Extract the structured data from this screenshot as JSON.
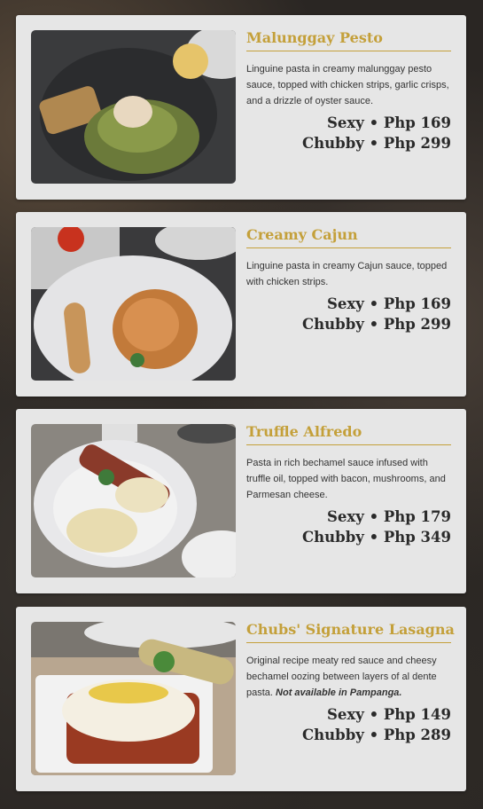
{
  "menu": {
    "items": [
      {
        "title": "Malunggay Pesto",
        "description": "Linguine pasta in creamy malunggay pesto sauce, topped with chicken strips, garlic crisps, and a drizzle of oyster sauce.",
        "note": "",
        "price_sexy": "Sexy • Php 169",
        "price_chubby": "Chubby • Php 299",
        "photo_alt": "pesto-pasta-photo"
      },
      {
        "title": "Creamy Cajun",
        "description": "Linguine pasta in creamy Cajun sauce, topped with chicken strips.",
        "note": "",
        "price_sexy": "Sexy • Php 169",
        "price_chubby": "Chubby • Php 299",
        "photo_alt": "cajun-pasta-photo"
      },
      {
        "title": "Truffle Alfredo",
        "description": "Pasta in rich bechamel sauce infused with truffle oil, topped with bacon, mushrooms, and Parmesan cheese.",
        "note": "",
        "price_sexy": "Sexy • Php 179",
        "price_chubby": "Chubby • Php 349",
        "photo_alt": "alfredo-pasta-photo"
      },
      {
        "title": "Chubs' Signature Lasagna",
        "description": "Original recipe meaty red sauce and cheesy bechamel oozing between layers of al dente pasta.",
        "note": "Not available in Pampanga.",
        "price_sexy": "Sexy • Php 149",
        "price_chubby": "Chubby • Php 289",
        "photo_alt": "lasagna-photo"
      }
    ]
  },
  "colors": {
    "title_gold": "#c4a03a",
    "card_bg": "#e6e6e6",
    "price_text": "#2a2a2a"
  }
}
